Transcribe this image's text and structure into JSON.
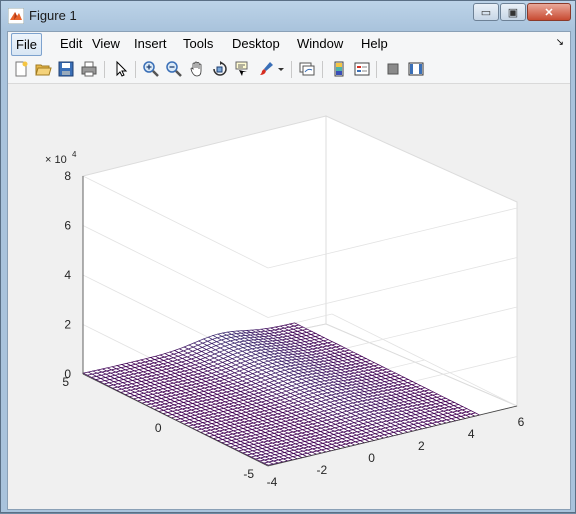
{
  "window": {
    "title": "Figure 1"
  },
  "caption_buttons": {
    "minimize": "▭",
    "maximize": "▣",
    "close": "✕"
  },
  "menu": [
    {
      "label": "File"
    },
    {
      "label": "Edit"
    },
    {
      "label": "View"
    },
    {
      "label": "Insert"
    },
    {
      "label": "Tools"
    },
    {
      "label": "Desktop"
    },
    {
      "label": "Window"
    },
    {
      "label": "Help"
    }
  ],
  "toolbar_icons": [
    "new-figure-icon",
    "open-file-icon",
    "save-icon",
    "print-icon",
    "edit-plot-icon",
    "zoom-in-icon",
    "zoom-out-icon",
    "pan-icon",
    "rotate-3d-icon",
    "data-cursor-icon",
    "brush-icon",
    "link-plot-icon",
    "insert-colorbar-icon",
    "insert-legend-icon",
    "hide-plot-tools-icon",
    "show-plot-tools-icon"
  ],
  "axes": {
    "exponent_label": "× 10",
    "exponent_power": "4",
    "z_ticks": [
      "0",
      "2",
      "4",
      "6",
      "8"
    ],
    "y_ticks": [
      "5",
      "0",
      "-5"
    ],
    "x_ticks": [
      "-4",
      "-2",
      "0",
      "2",
      "4",
      "6"
    ]
  },
  "chart_data": {
    "type": "surface",
    "x_range": [
      -4,
      6
    ],
    "y_range": [
      -5,
      5
    ],
    "z_range": [
      0,
      80000
    ],
    "grid": true,
    "colormap": [
      "#440154",
      "#3b528b",
      "#21918c",
      "#5ec962",
      "#fde725"
    ],
    "colors": {
      "low": "#3d1b8c",
      "mid": "#2fa8b0",
      "high": "#fde725"
    }
  }
}
